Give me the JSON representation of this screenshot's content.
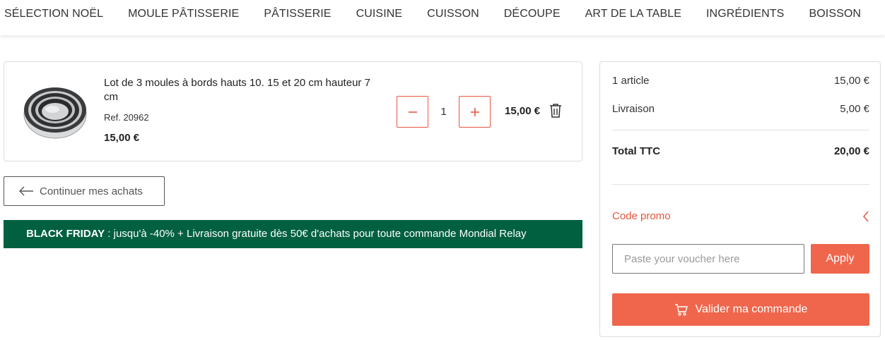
{
  "nav": {
    "items": [
      {
        "label": "SÉLECTION NOËL"
      },
      {
        "label": "MOULE PÂTISSERIE"
      },
      {
        "label": "PÂTISSERIE"
      },
      {
        "label": "CUISINE"
      },
      {
        "label": "CUISSON"
      },
      {
        "label": "DÉCOUPE"
      },
      {
        "label": "ART DE LA TABLE"
      },
      {
        "label": "INGRÉDIENTS"
      },
      {
        "label": "BOISSON"
      }
    ]
  },
  "cart_item": {
    "title": "Lot de 3 moules à bords hauts 10. 15 et 20 cm hauteur 7 cm",
    "ref": "Ref. 20962",
    "unit_price": "15,00 €",
    "quantity": "1",
    "line_total": "15,00 €",
    "image_icon": "round-cake-pan-set-image",
    "minus_icon": "minus-icon",
    "plus_icon": "plus-icon",
    "delete_icon": "trash-icon"
  },
  "continue_shopping": {
    "label": "Continuer mes achats",
    "icon": "arrow-left-icon"
  },
  "banner": {
    "bold": "BLACK FRIDAY",
    "text": " : jusqu'à -40% + Livraison gratuite dès 50€ d'achats pour toute commande Mondial Relay",
    "background": "#00603f"
  },
  "summary": {
    "articles_label": "1 article",
    "articles_value": "15,00 €",
    "shipping_label": "Livraison",
    "shipping_value": "5,00 €",
    "total_label": "Total TTC",
    "total_value": "20,00 €",
    "promo_label": "Code promo",
    "promo_icon": "chevron-left-icon",
    "voucher_placeholder": "Paste your voucher here",
    "apply_label": "Apply",
    "checkout_label": "Valider ma commande",
    "checkout_icon": "cart-icon"
  },
  "colors": {
    "accent": "#ef664c",
    "accent_text": "#e1573d",
    "banner_green": "#00603f"
  }
}
